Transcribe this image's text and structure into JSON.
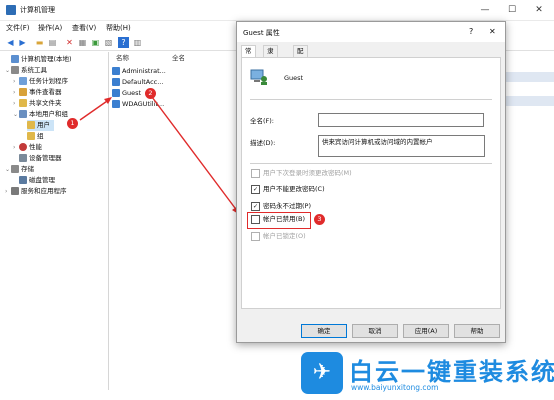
{
  "main_window": {
    "title": "计算机管理",
    "controls": {
      "minimize": "—",
      "maximize": "☐",
      "close": "✕"
    },
    "menu": [
      "文件(F)",
      "操作(A)",
      "查看(V)",
      "帮助(H)"
    ],
    "toolbar_icons": [
      "back-arrow",
      "forward-arrow",
      "folder",
      "up-folder",
      "delete",
      "properties",
      "refresh",
      "export",
      "help",
      "show-hide"
    ]
  },
  "tree": [
    {
      "label": "计算机管理(本地)",
      "expand": "",
      "icon": "computer-icon",
      "indent": 0,
      "selected": false
    },
    {
      "label": "系统工具",
      "expand": "⌄",
      "icon": "tools-icon",
      "indent": 1,
      "selected": false
    },
    {
      "label": "任务计划程序",
      "expand": "›",
      "icon": "clock-icon",
      "indent": 2,
      "selected": false
    },
    {
      "label": "事件查看器",
      "expand": "›",
      "icon": "event-icon",
      "indent": 2,
      "selected": false
    },
    {
      "label": "共享文件夹",
      "expand": "›",
      "icon": "folder-icon",
      "indent": 2,
      "selected": false
    },
    {
      "label": "本地用户和组",
      "expand": "⌄",
      "icon": "users-icon",
      "indent": 2,
      "selected": false
    },
    {
      "label": "用户",
      "expand": "",
      "icon": "folder-icon",
      "indent": 3,
      "selected": true
    },
    {
      "label": "组",
      "expand": "",
      "icon": "folder-icon",
      "indent": 3,
      "selected": false
    },
    {
      "label": "性能",
      "expand": "›",
      "icon": "performance-icon",
      "indent": 2,
      "selected": false
    },
    {
      "label": "设备管理器",
      "expand": "",
      "icon": "device-icon",
      "indent": 2,
      "selected": false
    },
    {
      "label": "存储",
      "expand": "⌄",
      "icon": "storage-icon",
      "indent": 1,
      "selected": false
    },
    {
      "label": "磁盘管理",
      "expand": "",
      "icon": "disk-icon",
      "indent": 2,
      "selected": false
    },
    {
      "label": "服务和应用程序",
      "expand": "›",
      "icon": "services-icon",
      "indent": 1,
      "selected": false
    }
  ],
  "list": {
    "columns": [
      "名称",
      "全名"
    ],
    "rows": [
      "Administrat...",
      "DefaultAcc...",
      "Guest",
      "WDAGUtilit..."
    ]
  },
  "dialog": {
    "title": "Guest 属性",
    "help": "?",
    "close": "✕",
    "tabs": [
      "常规",
      "隶属于",
      "配置文件"
    ],
    "username": "Guest",
    "fullname_label": "全名(F):",
    "fullname_value": "",
    "desc_label": "描述(D):",
    "desc_value": "供来宾访问计算机或访问域的内置帐户",
    "checkboxes": [
      {
        "label": "用户下次登录时须更改密码(M)",
        "checked": false,
        "disabled": true
      },
      {
        "label": "用户不能更改密码(C)",
        "checked": true,
        "disabled": false
      },
      {
        "label": "密码永不过期(P)",
        "checked": true,
        "disabled": false
      },
      {
        "label": "帐户已禁用(B)",
        "checked": false,
        "disabled": false
      },
      {
        "label": "帐户已锁定(O)",
        "checked": false,
        "disabled": true
      }
    ],
    "buttons": [
      "确定",
      "取消",
      "应用(A)",
      "帮助"
    ]
  },
  "annotations": [
    "1",
    "2",
    "3"
  ],
  "accent_color": "#e02b2b",
  "watermark": {
    "brand": "白云一键重装系统",
    "url": "www.baiyunxitong.com"
  }
}
